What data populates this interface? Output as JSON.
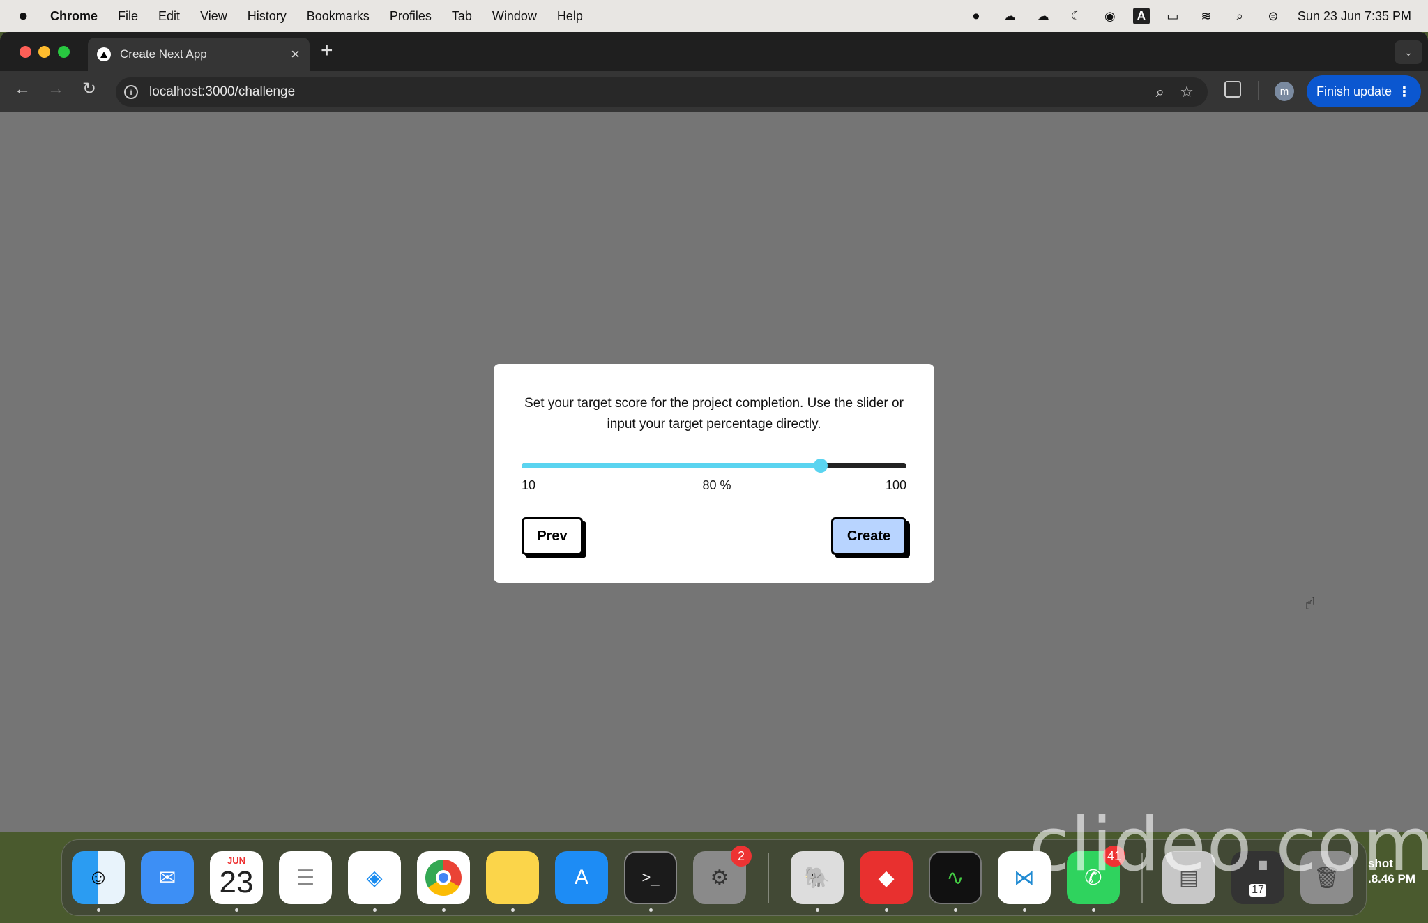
{
  "menubar": {
    "apple": "",
    "items": [
      "Chrome",
      "File",
      "Edit",
      "View",
      "History",
      "Bookmarks",
      "Profiles",
      "Tab",
      "Window",
      "Help"
    ],
    "clock": "Sun 23 Jun  7:35 PM",
    "input_source": "A"
  },
  "browser": {
    "tab_title": "Create Next App",
    "url": "localhost:3000/challenge",
    "finish_update_label": "Finish update",
    "profile_initial": "m"
  },
  "modal": {
    "prompt": "Set your target score for the project completion. Use the slider or input your target percentage directly.",
    "slider": {
      "min": "10",
      "max": "100",
      "value": 80,
      "value_label": "80 %"
    },
    "prev_label": "Prev",
    "create_label": "Create"
  },
  "dock": {
    "calendar_month": "JUN",
    "calendar_day": "23",
    "settings_badge": "2",
    "whatsapp_badge": "41",
    "mini_calendar_day": "17"
  },
  "overlay": {
    "watermark": "clideo.com",
    "screenshot_label_1": "shot",
    "screenshot_label_2": ".8.46 PM"
  },
  "colors": {
    "accent_slider": "#5ad4f0",
    "create_button": "#b8d4ff",
    "finish_update": "#0b57d0"
  }
}
